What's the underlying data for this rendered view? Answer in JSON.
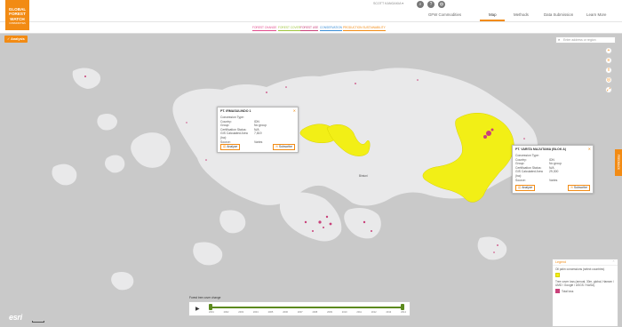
{
  "brand": {
    "line1": "GLOBAL",
    "line2": "FOREST",
    "line3": "WATCH",
    "line4": "COMMODITIES"
  },
  "user": {
    "label": "SCOTT KANGAKIA ▾"
  },
  "nav": {
    "items": [
      "GFW Commodities",
      "Map",
      "Methods",
      "Data Submission",
      "Learn More"
    ],
    "active": "Map"
  },
  "subnav": {
    "tabs": [
      {
        "label": "FOREST CHANGE",
        "color": "#e24c8d"
      },
      {
        "label": "FOREST COVER",
        "color": "#9fc43e"
      },
      {
        "label": "FOREST USE",
        "color": "#c9417a"
      },
      {
        "label": "CONSERVATION",
        "color": "#3d8fd6"
      },
      {
        "label": "PRODUCTION SUSTAINABILITY",
        "color": "#f28b14"
      }
    ]
  },
  "analysis": {
    "label": "Analysis"
  },
  "search": {
    "placeholder": "Enter address or region"
  },
  "feedback": {
    "label": "FEEDBACK"
  },
  "popup_left": {
    "title": "PT. IRMASULINDO 1",
    "rows": [
      {
        "k": "Concession Type:",
        "v": ""
      },
      {
        "k": "Country:",
        "v": "IDN"
      },
      {
        "k": "Group:",
        "v": "No group"
      },
      {
        "k": "Certification Status:",
        "v": "N/A"
      },
      {
        "k": "GIS Calculated Area (ha):",
        "v": "7,819"
      },
      {
        "k": "Source:",
        "v": "Varies"
      }
    ],
    "analyze": "Analyze",
    "subscribe": "Subscribe"
  },
  "popup_right": {
    "title": "PT. VARITA MAJUTAMA (BLOK A)",
    "rows": [
      {
        "k": "Concession Type:",
        "v": ""
      },
      {
        "k": "Country:",
        "v": "IDN"
      },
      {
        "k": "Group:",
        "v": "No group"
      },
      {
        "k": "Certification Status:",
        "v": "N/A"
      },
      {
        "k": "GIS Calculated Area (ha):",
        "v": "29,300"
      },
      {
        "k": "Source:",
        "v": "Varies"
      }
    ],
    "analyze": "Analyze",
    "subscribe": "Subscribe"
  },
  "legend": {
    "title": "Legend",
    "item1": "Oil palm concessions (select countries)",
    "item1_color": "#f2ef16",
    "item2": "Tree cover loss (annual, 30m, global, Hansen / UMD / Google / USGS / NASA)",
    "item2_color": "#c9417a",
    "item3": "Total loss"
  },
  "timeline": {
    "label": "Forest tree cover change",
    "years": [
      "2001",
      "2002",
      "2003",
      "2004",
      "2005",
      "2006",
      "2007",
      "2008",
      "2009",
      "2010",
      "2011",
      "2012",
      "2013",
      "2014"
    ]
  },
  "map": {
    "place_label": "Bintuni"
  },
  "attribution": {
    "esri": "esri"
  }
}
